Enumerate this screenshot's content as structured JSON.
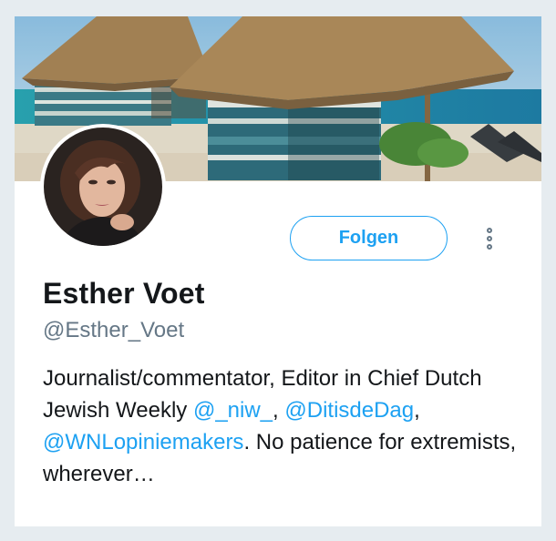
{
  "profile": {
    "name": "Esther Voet",
    "handle": "@Esther_Voet",
    "follow_label": "Folgen",
    "more_icon": "more-vertical-icon",
    "bio": {
      "part1": "Journalist/commentator, Editor in Chief Dutch Jewish Weekly ",
      "mention1": "@_niw_",
      "sep1": ", ",
      "mention2": "@DitisdeDag",
      "sep2": ", ",
      "mention3": "@WNLopiniemakers",
      "part2": ". No patience for extremists, wherever…"
    }
  },
  "colors": {
    "accent": "#1da1f2",
    "text_primary": "#14171a",
    "text_secondary": "#657786",
    "page_background": "#e6ecf0"
  }
}
